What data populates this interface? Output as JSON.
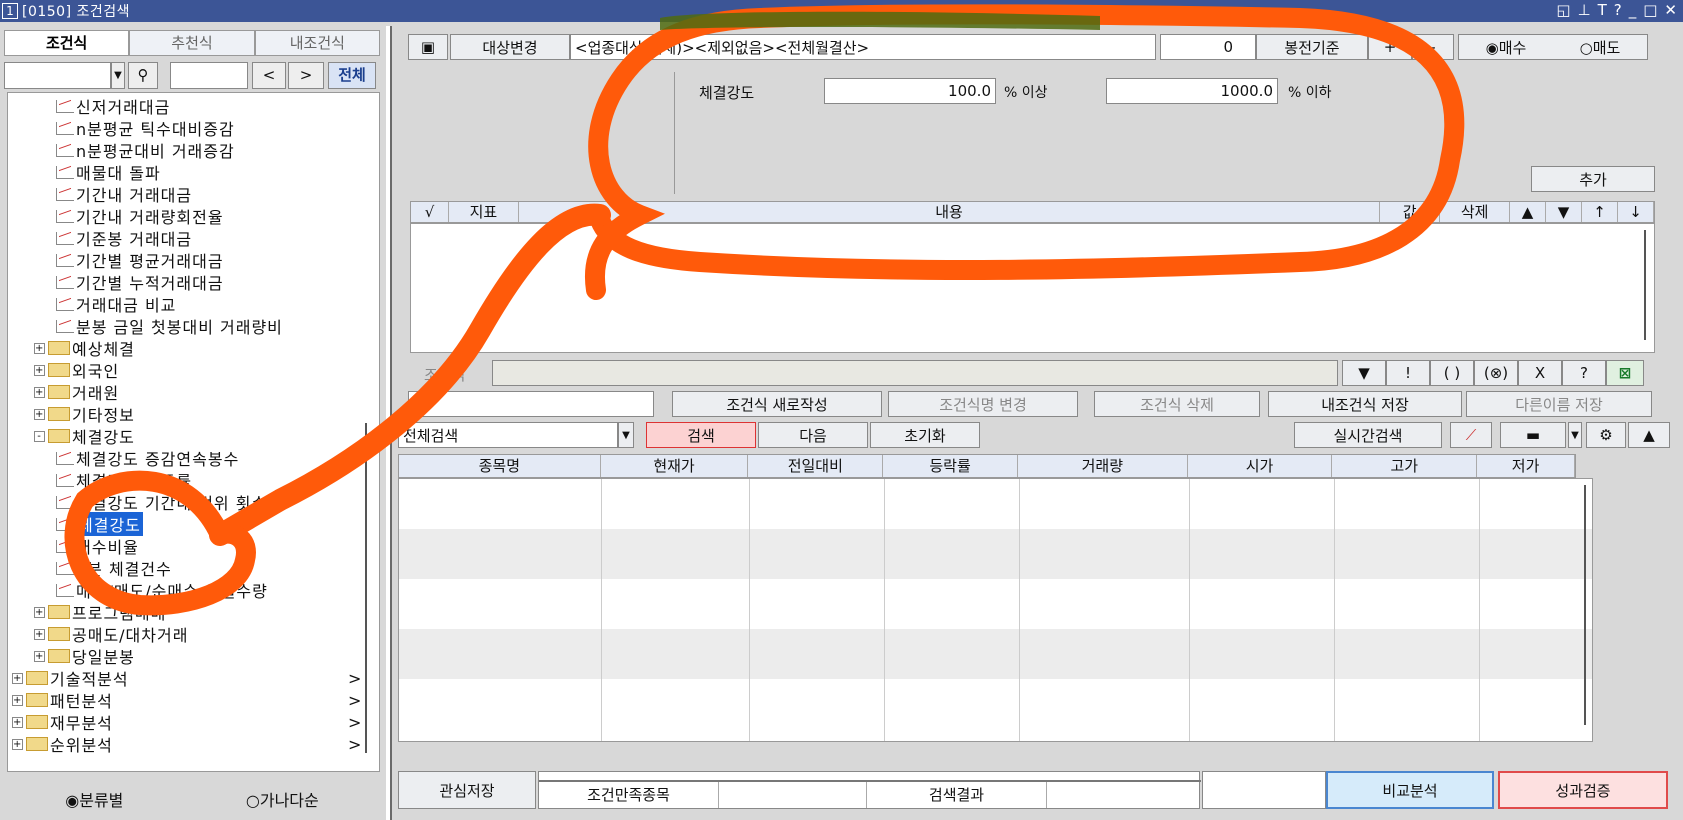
{
  "window": {
    "num": "1",
    "title": "[0150] 조건검색",
    "icons": [
      "restore",
      "pin",
      "T",
      "?",
      "_",
      "□",
      "✕"
    ]
  },
  "left": {
    "tabs": [
      "조건식",
      "추천식",
      "내조건식"
    ],
    "search_btn": "search-icon",
    "prev": "<",
    "next": ">",
    "all": "전체",
    "tree": [
      {
        "label": "신저거래대금",
        "type": "leaf",
        "indent": 2
      },
      {
        "label": "n분평균 틱수대비증감",
        "type": "leaf",
        "indent": 2
      },
      {
        "label": "n분평균대비 거래증감",
        "type": "leaf",
        "indent": 2
      },
      {
        "label": "매물대 돌파",
        "type": "leaf",
        "indent": 2
      },
      {
        "label": "기간내 거래대금",
        "type": "leaf",
        "indent": 2
      },
      {
        "label": "기간내 거래량회전율",
        "type": "leaf",
        "indent": 2
      },
      {
        "label": "기준봉 거래대금",
        "type": "leaf",
        "indent": 2
      },
      {
        "label": "기간별 평균거래대금",
        "type": "leaf",
        "indent": 2
      },
      {
        "label": "기간별 누적거래대금",
        "type": "leaf",
        "indent": 2
      },
      {
        "label": "거래대금 비교",
        "type": "leaf",
        "indent": 2
      },
      {
        "label": "분봉 금일 첫봉대비 거래량비",
        "type": "leaf",
        "indent": 2
      },
      {
        "label": "예상체결",
        "type": "folder",
        "indent": 1,
        "sign": "+"
      },
      {
        "label": "외국인",
        "type": "folder",
        "indent": 1,
        "sign": "+"
      },
      {
        "label": "거래원",
        "type": "folder",
        "indent": 1,
        "sign": "+"
      },
      {
        "label": "기타정보",
        "type": "folder",
        "indent": 1,
        "sign": "+"
      },
      {
        "label": "체결강도",
        "type": "folder",
        "indent": 1,
        "sign": "-"
      },
      {
        "label": "체결강도 증감연속봉수",
        "type": "leaf",
        "indent": 2
      },
      {
        "label": "체결강도 변동률",
        "type": "leaf",
        "indent": 2
      },
      {
        "label": "체결강도 기간내 범위 횟수",
        "type": "leaf",
        "indent": 2
      },
      {
        "label": "체결강도",
        "type": "leaf",
        "indent": 2,
        "selected": true
      },
      {
        "label": "매수비율",
        "type": "leaf",
        "indent": 2
      },
      {
        "label": "n분 체결건수",
        "type": "leaf",
        "indent": 2
      },
      {
        "label": "매수/매도/순매수 체결수량",
        "type": "leaf",
        "indent": 2
      },
      {
        "label": "프로그램매매",
        "type": "folder",
        "indent": 1,
        "sign": "+"
      },
      {
        "label": "공매도/대차거래",
        "type": "folder",
        "indent": 1,
        "sign": "+"
      },
      {
        "label": "당일분봉",
        "type": "folder",
        "indent": 1,
        "sign": "+"
      },
      {
        "label": "기술적분석",
        "type": "folder",
        "indent": 0,
        "sign": "+",
        "arrow": ">"
      },
      {
        "label": "패턴분석",
        "type": "folder",
        "indent": 0,
        "sign": "+",
        "arrow": ">"
      },
      {
        "label": "재무분석",
        "type": "folder",
        "indent": 0,
        "sign": "+",
        "arrow": ">"
      },
      {
        "label": "순위분석",
        "type": "folder",
        "indent": 0,
        "sign": "+",
        "arrow": ">"
      }
    ],
    "radio1": "분류별",
    "radio2": "가나다순"
  },
  "top": {
    "target_btn": "대상변경",
    "target_text": "<업종대상(전체)><제외없음><전체월결산>",
    "count": "0",
    "basis": "봉전기준",
    "plus": "+",
    "minus": "-",
    "buy": "매수",
    "sell": "매도"
  },
  "strength": {
    "label": "체결강도",
    "min": "100.0",
    "min_unit": "% 이상",
    "max": "1000.0",
    "max_unit": "% 이하",
    "add": "추가"
  },
  "cond_grid": {
    "headers": [
      "√",
      "지표",
      "내용",
      "값",
      "삭제",
      "▲",
      "▼",
      "↑",
      "↓"
    ]
  },
  "formula": {
    "label": "조건식",
    "btns": [
      "▼",
      "!",
      "( )",
      "(⊗)",
      "X",
      "?"
    ]
  },
  "actions": {
    "new": "조건식 새로작성",
    "rename": "조건식명 변경",
    "delete": "조건식 삭제",
    "save": "내조건식 저장",
    "saveas": "다른이름 저장"
  },
  "search": {
    "select": "전체검색",
    "search": "검색",
    "next": "다음",
    "reset": "초기화",
    "realtime": "실시간검색"
  },
  "result": {
    "headers": [
      "종목명",
      "현재가",
      "전일대비",
      "등락률",
      "거래량",
      "시가",
      "고가",
      "저가"
    ]
  },
  "footer": {
    "fav": "관심저장",
    "tab1": "조건만족종목",
    "tab2": "검색결과",
    "compare": "비교분석",
    "verify": "성과검증"
  },
  "colors": {
    "title": "#3c5596",
    "annotation": "#ff5a0a",
    "selected": "#1b64d6"
  }
}
